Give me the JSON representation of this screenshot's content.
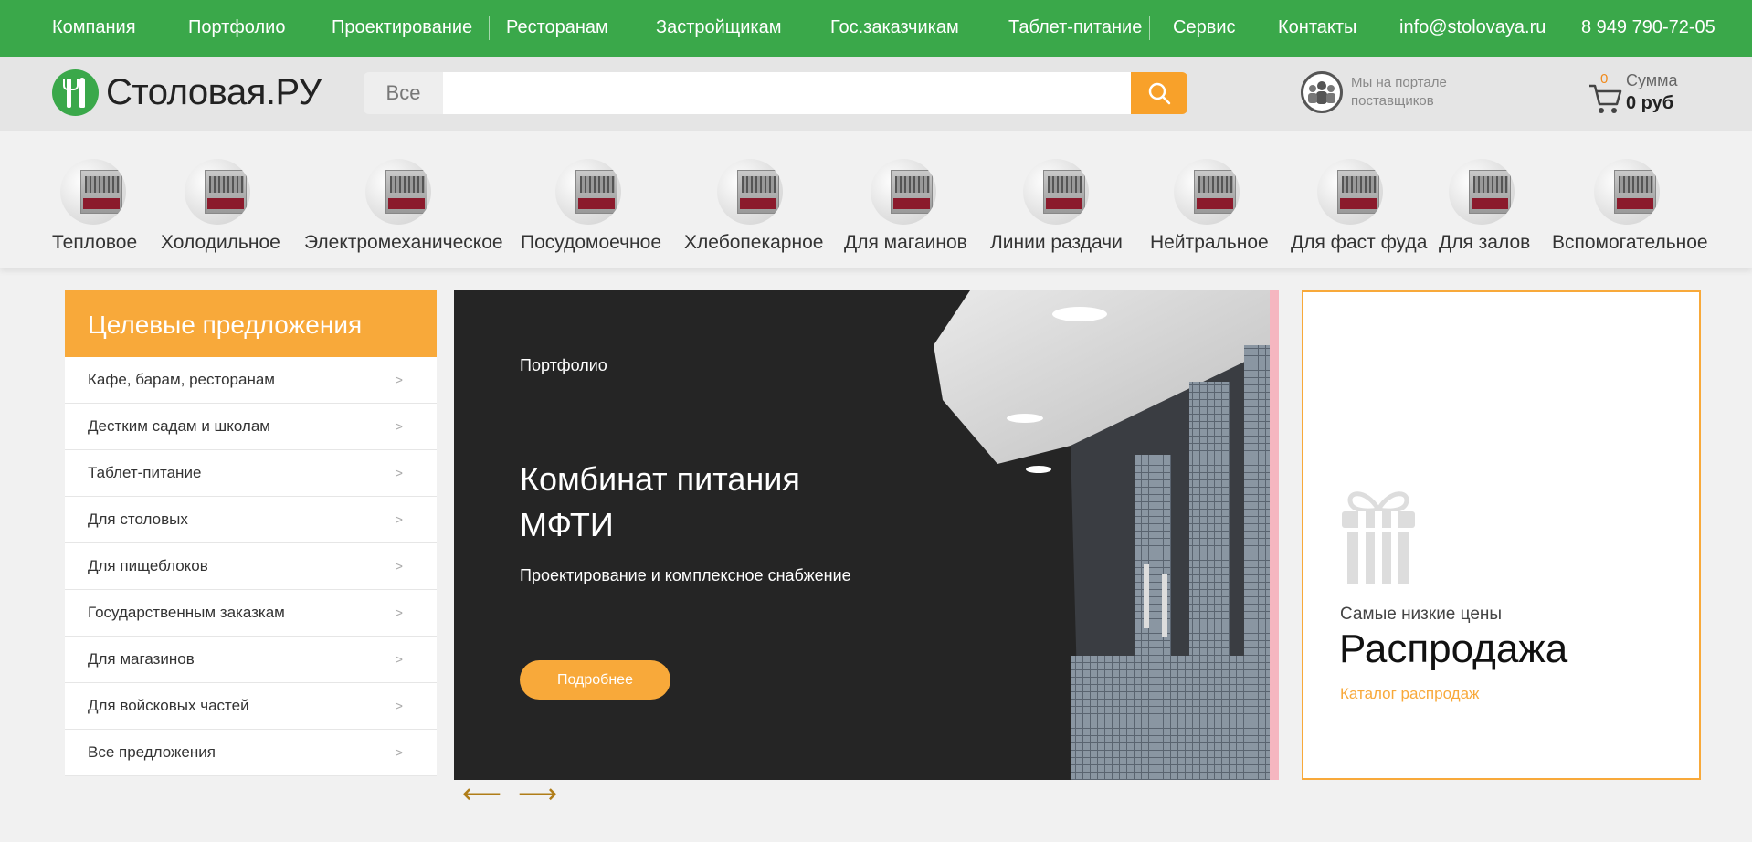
{
  "topnav": {
    "items": [
      "Компания",
      "Портфолио",
      "Проектирование",
      "Ресторанам",
      "Застройщикам",
      "Гос.заказчикам",
      "Таблет-питание",
      "Сервис",
      "Контакты"
    ],
    "email": "info@stolovaya.ru",
    "phone": "8 949 790-72-05",
    "color": "#3aa84a"
  },
  "header": {
    "logo_text": "Столовая.РУ",
    "search_category": "Все",
    "search_value": "",
    "portal_text": "Мы на портале поставщиков",
    "cart_count": "0",
    "cart_sum_label": "Сумма",
    "cart_sum": "0 руб"
  },
  "categories": [
    "Тепловое",
    "Холодильное",
    "Электромеханическое",
    "Посудомоечное",
    "Хлебопекарное",
    "Для магаинов",
    "Линии раздачи",
    "Нейтральное",
    "Для фаст фуда",
    "Для залов",
    "Вспомогательное"
  ],
  "offers": {
    "title": "Целевые предложения",
    "items": [
      "Кафе, барам, ресторанам",
      "Дестким садам и школам",
      "Таблет-питание",
      "Для столовых",
      "Для пищеблоков",
      "Государственным заказкам",
      "Для магазинов",
      "Для войсковых частей",
      "Все предложения"
    ],
    "arrow": ">",
    "accent": "#f8a93a"
  },
  "slider": {
    "category": "Портфолио",
    "title": "Комбинат питания МФТИ",
    "subtitle": "Проектирование и комплексное снабжение",
    "button": "Подробнее",
    "prev_icon": "left-arrow-icon",
    "next_icon": "right-arrow-icon"
  },
  "sale": {
    "subtitle": "Самые низкие цены",
    "title": "Распродажа",
    "link": "Каталог распродаж"
  }
}
